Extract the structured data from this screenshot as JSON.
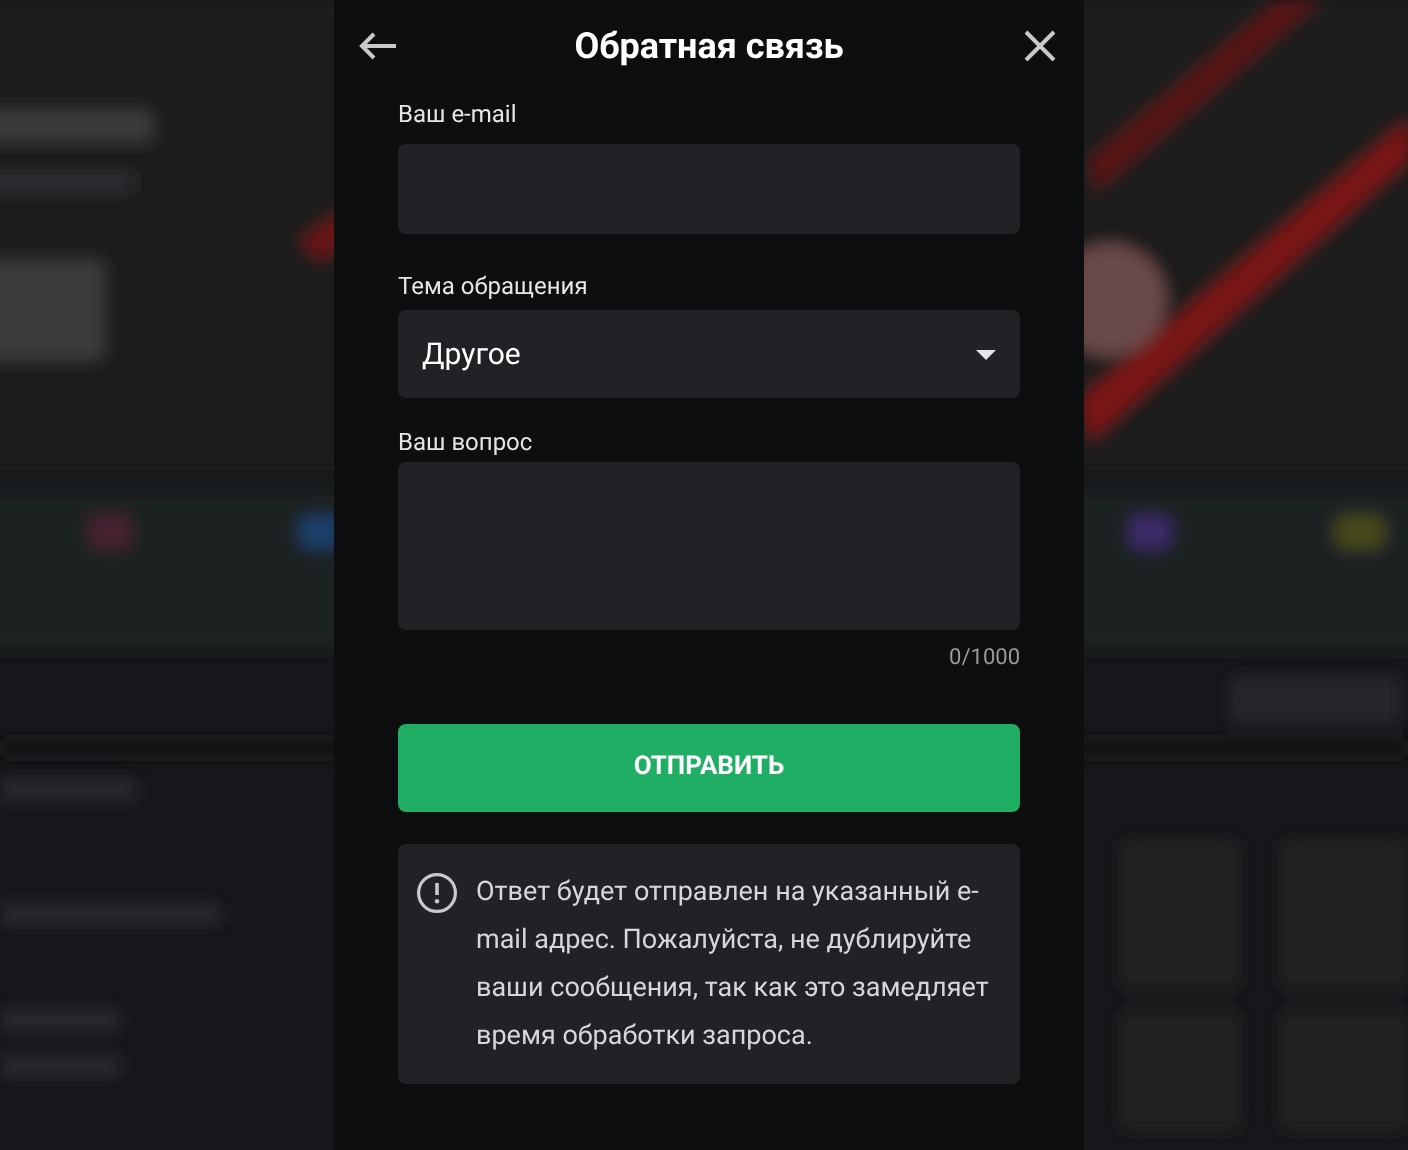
{
  "dialog": {
    "title": "Обратная связь"
  },
  "email": {
    "label": "Ваш e-mail"
  },
  "topic": {
    "label": "Тема обращения",
    "value": "Другое"
  },
  "question": {
    "label": "Ваш вопрос",
    "counter": "0/1000"
  },
  "submit": {
    "label": "ОТПРАВИТЬ"
  },
  "notice": {
    "text": "Ответ будет отправлен на указанный e-mail адрес. Пожалуйста, не дублируйте ваши сообщения, так как это замедляет время обработки запроса."
  }
}
